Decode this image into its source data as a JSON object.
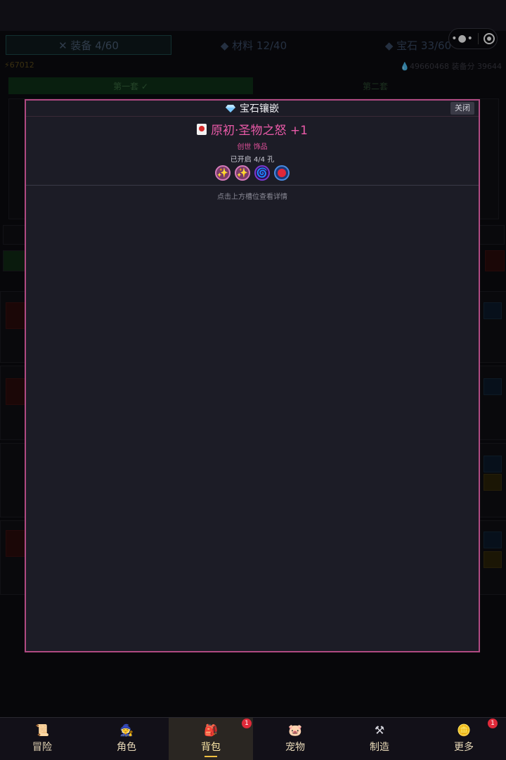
{
  "background_page": {
    "tabs": [
      {
        "label": "✕ 装备 4/60"
      },
      {
        "label": "◆ 材料 12/40"
      },
      {
        "label": "◆ 宝石 33/60"
      }
    ],
    "resource_left": "⚡67012",
    "resource_right": "💧49660468  装备分 39644",
    "set_tabs": [
      {
        "label": "第一套 ✓"
      },
      {
        "label": "第二套"
      }
    ]
  },
  "modal": {
    "title": "宝石镶嵌",
    "close_label": "关闭",
    "item_name": "原初·圣物之怒 +1",
    "item_subtitle": "创世 饰品",
    "item_slots": "已开启 4/4 孔",
    "sockets": [
      {
        "icon": "sparkle-gem-icon",
        "glyph": "✨"
      },
      {
        "icon": "sparkle-gem-icon",
        "glyph": "✨"
      },
      {
        "icon": "swirl-gem-icon",
        "glyph": "🌀"
      },
      {
        "icon": "ruby-gem-icon",
        "glyph": ""
      }
    ],
    "hint": "点击上方槽位查看详情",
    "accent_color": "#b04a82",
    "name_color": "#ea5aa8"
  },
  "bottom_nav": {
    "items": [
      {
        "label": "冒险",
        "icon": "map-icon",
        "glyph": "📜",
        "badge": ""
      },
      {
        "label": "角色",
        "icon": "hero-icon",
        "glyph": "🧙",
        "badge": ""
      },
      {
        "label": "背包",
        "icon": "backpack-icon",
        "glyph": "🎒",
        "badge": "1"
      },
      {
        "label": "宠物",
        "icon": "pet-icon",
        "glyph": "🐷",
        "badge": ""
      },
      {
        "label": "制造",
        "icon": "anvil-icon",
        "glyph": "⚒",
        "badge": ""
      },
      {
        "label": "更多",
        "icon": "more-icon",
        "glyph": "🪙",
        "badge": "1"
      }
    ],
    "active_index": 2
  }
}
